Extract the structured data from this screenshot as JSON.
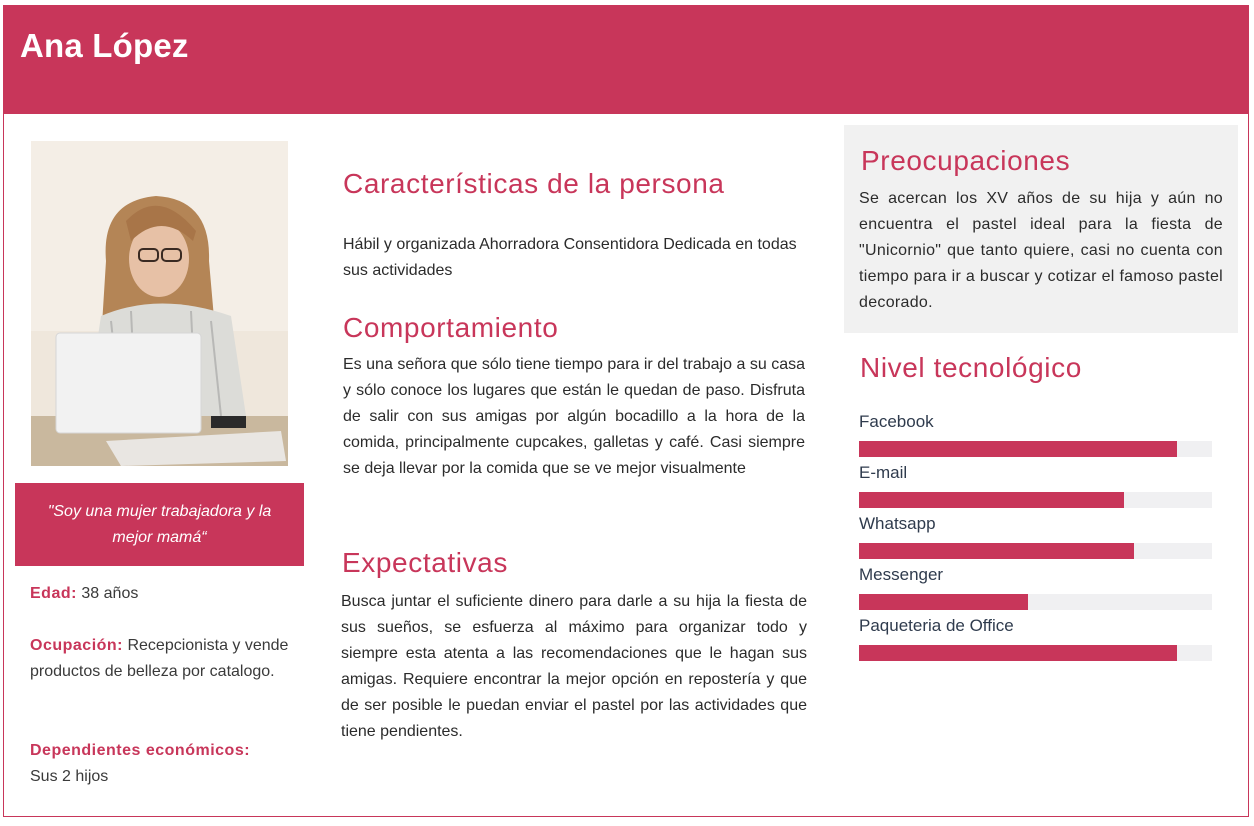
{
  "persona": {
    "name": "Ana López",
    "quote": "\"Soy una mujer trabajadora y la mejor mamá“",
    "age_label": "Edad:",
    "age_value": "38 años",
    "job_label": "Ocupación:",
    "job_value": "Recepcionista y vende productos de belleza por catalogo.",
    "dependents_label": "Dependientes económicos:",
    "dependents_value": "Sus 2 hijos"
  },
  "sections": {
    "characteristics_title": "Características de la persona",
    "characteristics_text": "Hábil y organizada Ahorradora Consentidora Dedicada en todas sus actividades",
    "behavior_title": "Comportamiento",
    "behavior_text": "Es una señora que sólo tiene tiempo para ir del trabajo a su casa y sólo conoce los lugares que están le quedan de paso.  Disfruta de salir con sus amigas por algún bocadillo a la hora de la comida, principalmente cupcakes, galletas y café. Casi siempre se deja llevar por la comida que se ve mejor visualmente",
    "expectations_title": "Expectativas",
    "expectations_text": "Busca juntar el suficiente dinero para darle a su hija la fiesta de sus sueños, se esfuerza al máximo para organizar todo y siempre esta atenta a las recomendaciones que le hagan sus amigas. Requiere encontrar la mejor opción en repostería y que de ser posible le puedan enviar el pastel por las actividades que tiene pendientes.",
    "concerns_title": "Preocupaciones",
    "concerns_text": "Se acercan los XV años de su hija y aún no encuentra el pastel ideal para la fiesta de \"Unicornio\" que tanto quiere, casi no cuenta con tiempo para ir a buscar y cotizar el famoso pastel decorado.",
    "tech_title": "Nivel tecnológico"
  },
  "tech_levels": [
    {
      "label": "Facebook",
      "level": 0.9
    },
    {
      "label": "E-mail",
      "level": 0.75
    },
    {
      "label": "Whatsapp",
      "level": 0.78
    },
    {
      "label": "Messenger",
      "level": 0.48
    },
    {
      "label": "Paqueteria de Office",
      "level": 0.9
    }
  ],
  "colors": {
    "accent": "#c8365a",
    "panel": "#f1f1f1",
    "track": "#f0f0f2"
  }
}
